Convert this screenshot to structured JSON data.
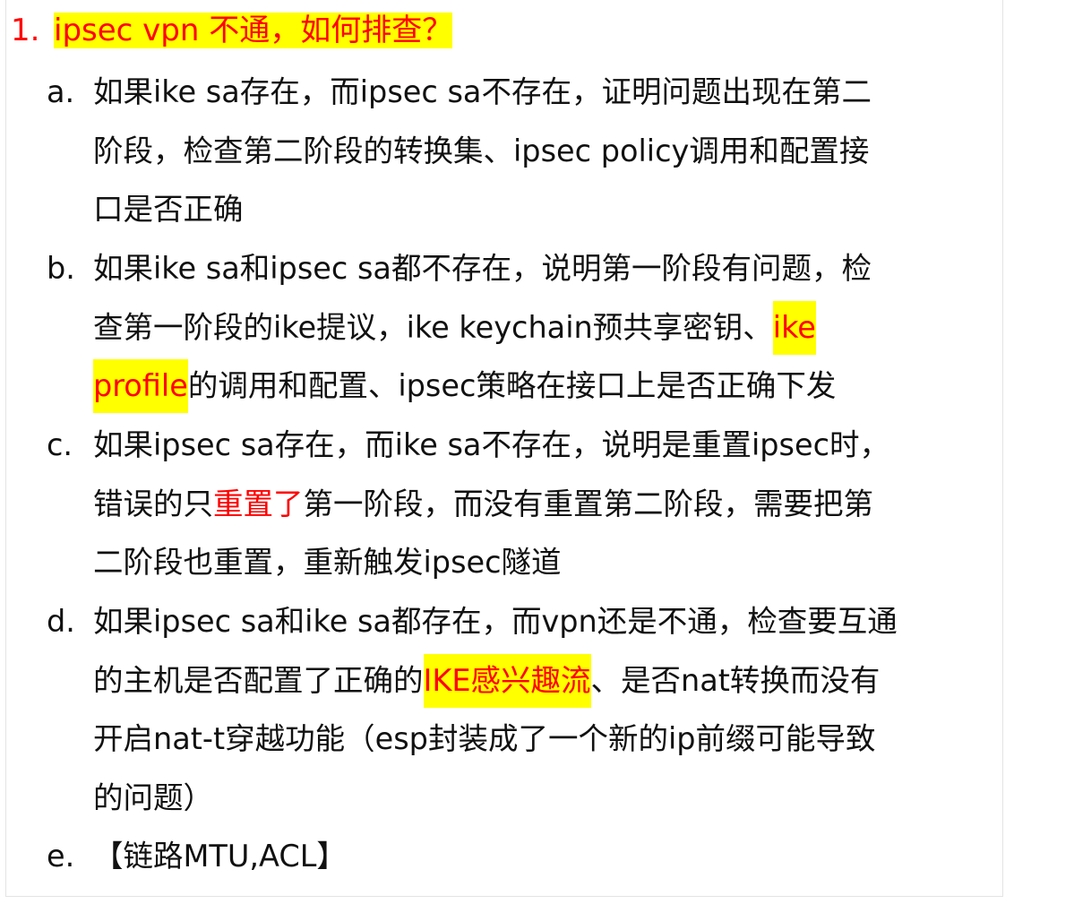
{
  "title": {
    "number": "1.",
    "text": "ipsec vpn 不通，如何排查？"
  },
  "items": [
    {
      "marker": "a.",
      "lines": [
        "如果ike sa存在，而ipsec sa不存在，证明问题出现在第二",
        "阶段，检查第二阶段的转换集、ipsec policy调用和配置接",
        "口是否正确"
      ]
    },
    {
      "marker": "b.",
      "line1": "如果ike sa和ipsec sa都不存在，说明第一阶段有问题，检",
      "line2_pre": "查第一阶段的ike提议，ike keychain预共享密钥、",
      "line2_hl": "ike",
      "line3_hl": "profile",
      "line3_post": "的调用和配置、ipsec策略在接口上是否正确下发"
    },
    {
      "marker": "c.",
      "line1": "如果ipsec sa存在，而ike sa不存在，说明是重置ipsec时，",
      "line2_pre": "错误的只",
      "line2_red": "重置了",
      "line2_post": "第一阶段，而没有重置第二阶段，需要把第",
      "line3": "二阶段也重置，重新触发ipsec隧道"
    },
    {
      "marker": "d.",
      "line1": "如果ipsec sa和ike sa都存在，而vpn还是不通，检查要互通",
      "line2_pre": "的主机是否配置了正确的",
      "line2_hl": "IKE感兴趣流",
      "line2_post": "、是否nat转换而没有",
      "line3": "开启nat-t穿越功能（esp封装成了一个新的ip前缀可能导致",
      "line4": "的问题）"
    },
    {
      "marker": "e.",
      "line1": "【链路MTU,ACL】"
    }
  ],
  "colors": {
    "highlight": "#ffff00",
    "emphasis": "#ff0000",
    "text": "#111111"
  }
}
